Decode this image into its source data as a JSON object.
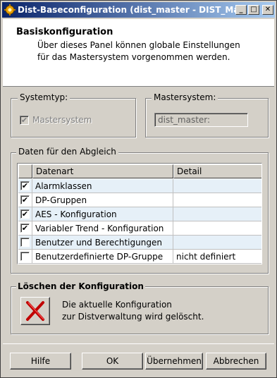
{
  "window": {
    "title": "Dist-Baseconfiguration (dist_master - DIST_Master; ...",
    "minimize_glyph": "_",
    "maximize_glyph": "□",
    "close_glyph": "✕"
  },
  "header": {
    "title": "Basiskonfiguration",
    "description_line1": "Über dieses Panel können globale Einstellungen",
    "description_line2": "für das Mastersystem vorgenommen werden."
  },
  "systemtyp": {
    "label": "Systemtyp:",
    "checkbox_label": "Mastersystem",
    "checked": true
  },
  "mastersystem": {
    "label": "Mastersystem:",
    "value": "dist_master:"
  },
  "abgleich": {
    "label": "Daten für den Abgleich",
    "columns": [
      "Datenart",
      "Detail"
    ],
    "rows": [
      {
        "checked": true,
        "datenart": "Alarmklassen",
        "detail": ""
      },
      {
        "checked": true,
        "datenart": "DP-Gruppen",
        "detail": ""
      },
      {
        "checked": true,
        "datenart": "AES - Konfiguration",
        "detail": ""
      },
      {
        "checked": true,
        "datenart": "Variabler Trend - Konfiguration",
        "detail": ""
      },
      {
        "checked": false,
        "datenart": "Benutzer und Berechtigungen",
        "detail": ""
      },
      {
        "checked": false,
        "datenart": "Benutzerdefinierte DP-Gruppe",
        "detail": "nicht definiert"
      }
    ]
  },
  "loeschen": {
    "label": "Löschen der Konfiguration",
    "description_line1": "Die aktuelle Konfiguration",
    "description_line2": "zur Distverwaltung wird gelöscht."
  },
  "buttons": {
    "hilfe": "Hilfe",
    "ok": "OK",
    "uebernehmen": "Übernehmen",
    "abbrechen": "Abbrechen"
  },
  "colors": {
    "title_gradient_start": "#0a246a",
    "title_gradient_end": "#a6caf0",
    "row_alt": "#e6f0f8",
    "delete_icon": "#c00000"
  }
}
